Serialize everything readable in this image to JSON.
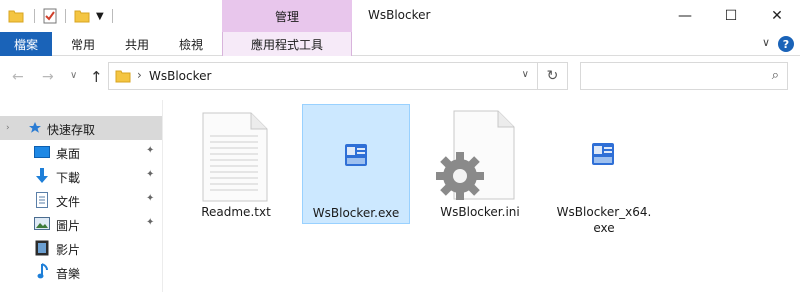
{
  "window": {
    "title": "WsBlocker",
    "context_tab_header": "管理",
    "minimize_glyph": "—",
    "maximize_glyph": "☐",
    "close_glyph": "✕"
  },
  "ribbon": {
    "tabs": [
      "檔案",
      "常用",
      "共用",
      "檢視",
      "應用程式工具"
    ],
    "collapse_glyph": "∨",
    "help_glyph": "?"
  },
  "address": {
    "path": "WsBlocker",
    "separator": "›",
    "dropdown_glyph": "∨",
    "refresh_glyph": "↻",
    "back_glyph": "←",
    "forward_glyph": "→",
    "recent_glyph": "∨",
    "up_glyph": "↑",
    "search_glyph": "⌕"
  },
  "nav": {
    "items": [
      {
        "label": "快速存取",
        "icon": "star-icon",
        "pinned": false
      },
      {
        "label": "桌面",
        "icon": "desktop-icon",
        "pinned": true
      },
      {
        "label": "下載",
        "icon": "download-icon",
        "pinned": true
      },
      {
        "label": "文件",
        "icon": "document-icon",
        "pinned": true
      },
      {
        "label": "圖片",
        "icon": "pictures-icon",
        "pinned": true
      },
      {
        "label": "影片",
        "icon": "video-icon",
        "pinned": false
      },
      {
        "label": "音樂",
        "icon": "music-icon",
        "pinned": false
      }
    ],
    "pin_glyph": "📌"
  },
  "files": [
    {
      "name": "Readme.txt",
      "icon": "text-file-icon",
      "selected": false
    },
    {
      "name": "WsBlocker.exe",
      "icon": "app-exe-icon",
      "selected": true
    },
    {
      "name": "WsBlocker.ini",
      "icon": "settings-file-icon",
      "selected": false
    },
    {
      "name": "WsBlocker_x64.\nexe",
      "icon": "app-exe-icon",
      "selected": false
    }
  ],
  "colors": {
    "file_tab": "#1a63b8",
    "context_tab": "#e8c6ec",
    "selection": "#cce8ff",
    "folder": "#f4c542"
  }
}
